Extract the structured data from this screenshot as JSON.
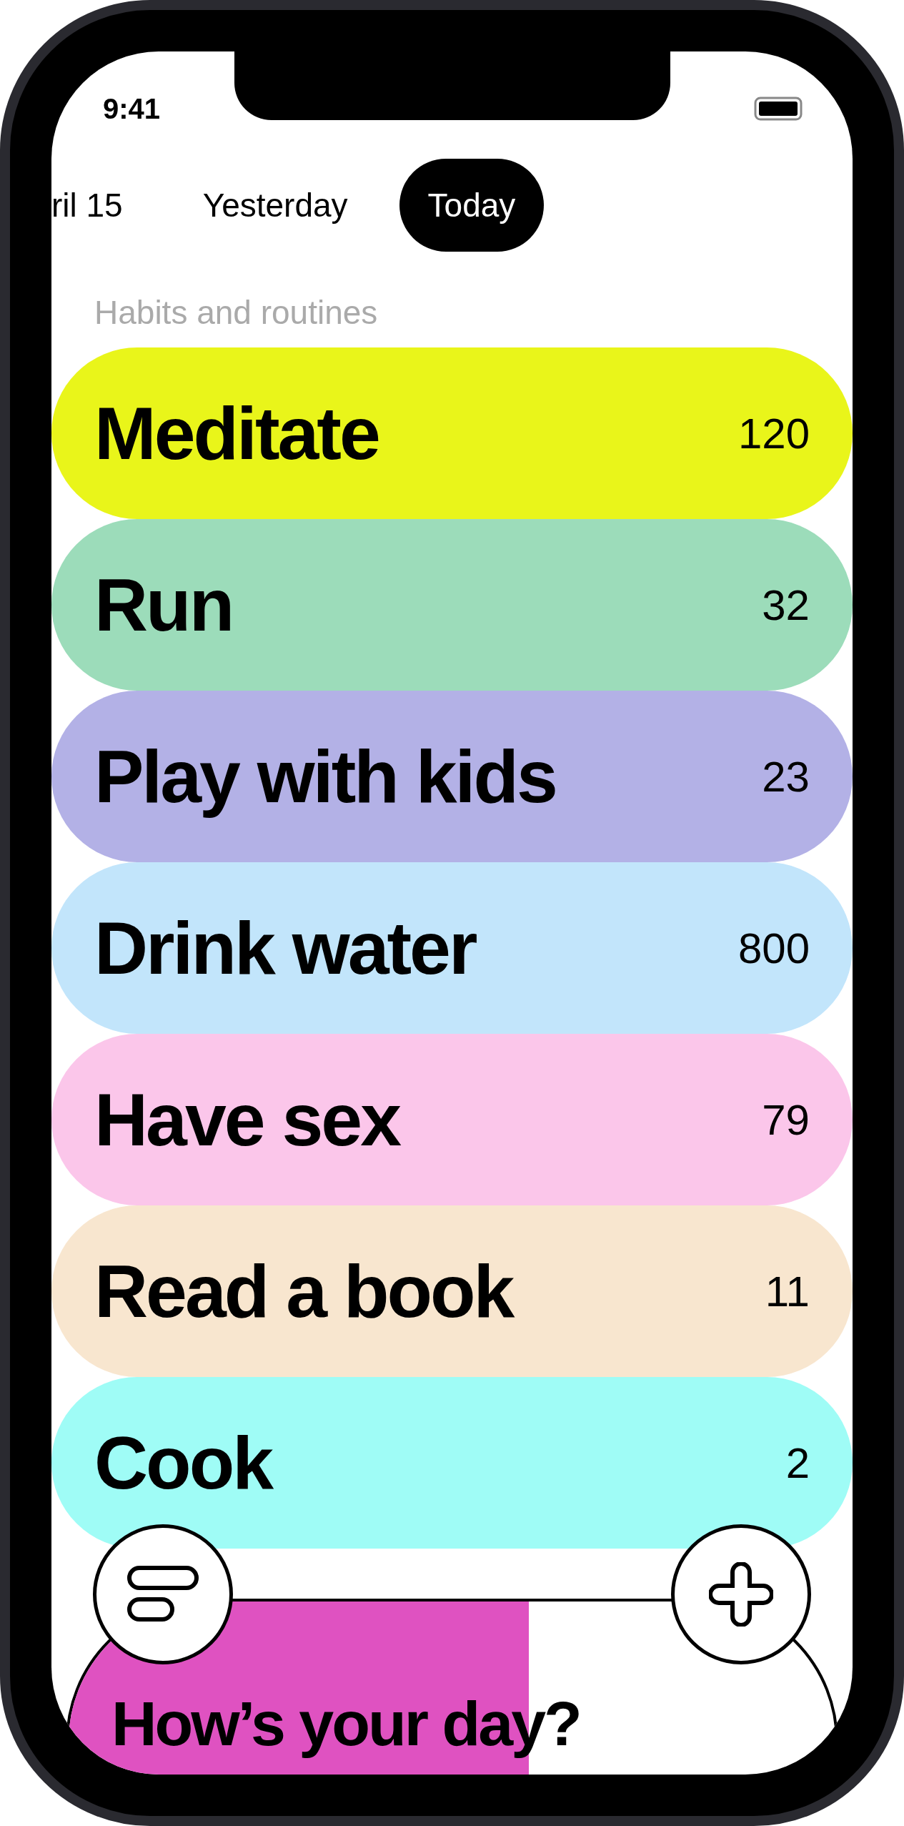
{
  "status_bar": {
    "time": "9:41"
  },
  "tabs": [
    {
      "label": "ril 15",
      "selected": false
    },
    {
      "label": "Yesterday",
      "selected": false
    },
    {
      "label": "Today",
      "selected": true
    }
  ],
  "section_title": "Habits and routines",
  "habits": [
    {
      "name": "Meditate",
      "count": "120",
      "color": "#e9f51a"
    },
    {
      "name": "Run",
      "count": "32",
      "color": "#9cdcba"
    },
    {
      "name": "Play with kids",
      "count": "23",
      "color": "#b3b1e6"
    },
    {
      "name": "Drink water",
      "count": "800",
      "color": "#c2e5fb"
    },
    {
      "name": "Have sex",
      "count": "79",
      "color": "#fbc6ea"
    },
    {
      "name": "Read a book",
      "count": "11",
      "color": "#f8e6cf"
    },
    {
      "name": "Cook",
      "count": "2",
      "color": "#9ffcf6"
    }
  ],
  "mood_card": {
    "title": "How’s your day?",
    "level": 0.6,
    "color": "#df52c1"
  }
}
